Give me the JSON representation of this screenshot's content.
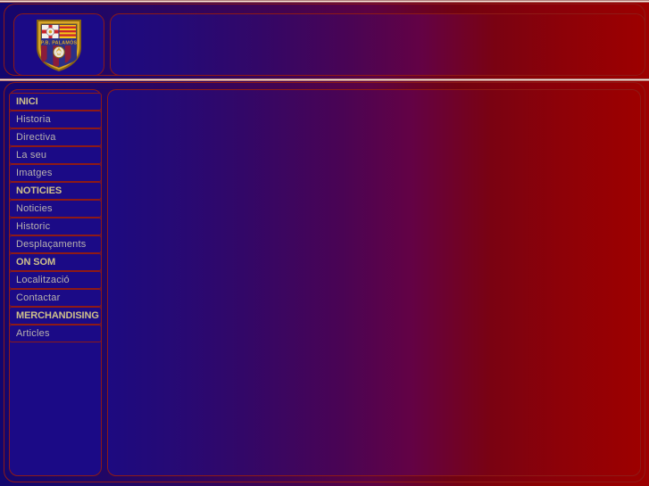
{
  "site": {
    "club_name": "P.B. PALAMÓS",
    "logo_alt": "club-crest"
  },
  "header": {
    "title": "",
    "right_panel_text": ""
  },
  "sidebar": {
    "items": [
      {
        "label": "INICI",
        "type": "section"
      },
      {
        "label": "Historia",
        "type": "link"
      },
      {
        "label": "Directiva",
        "type": "link"
      },
      {
        "label": "La seu",
        "type": "link"
      },
      {
        "label": "Imatges",
        "type": "link"
      },
      {
        "label": "NOTICIES",
        "type": "section"
      },
      {
        "label": "Noticies",
        "type": "link"
      },
      {
        "label": "Historic",
        "type": "link"
      },
      {
        "label": "Desplaçaments",
        "type": "link"
      },
      {
        "label": "ON SOM",
        "type": "section"
      },
      {
        "label": "Localització",
        "type": "link"
      },
      {
        "label": "Contactar",
        "type": "link"
      },
      {
        "label": "MERCHANDISING",
        "type": "section"
      },
      {
        "label": "Articles",
        "type": "link"
      }
    ]
  },
  "main": {
    "content_text": ""
  },
  "colors": {
    "gradient_start": "#12066e",
    "gradient_end": "#9d0000",
    "panel_border": "#8e1a16",
    "sidebar_bg": "#1b0a86",
    "section_text": "#cfc08a",
    "link_text": "#b9b3ae",
    "rule_light": "#fdf6ee"
  }
}
